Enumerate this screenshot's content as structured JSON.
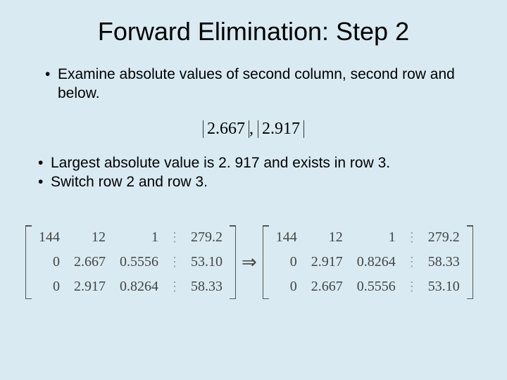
{
  "title": "Forward Elimination: Step 2",
  "bullets_top": [
    "Examine absolute values of second column, second row and below."
  ],
  "abs_expr": {
    "v1": "2.667",
    "comma": ", ",
    "v2": "2.917"
  },
  "bullets_mid": [
    "Largest absolute value is 2. 917 and exists in row 3.",
    "Switch row 2 and row 3."
  ],
  "matrices": {
    "left": {
      "rows": [
        [
          "144",
          "12",
          "1",
          "279.2"
        ],
        [
          "0",
          "2.667",
          "0.5556",
          "53.10"
        ],
        [
          "0",
          "2.917",
          "0.8264",
          "58.33"
        ]
      ]
    },
    "arrow": "⇒",
    "right": {
      "rows": [
        [
          "144",
          "12",
          "1",
          "279.2"
        ],
        [
          "0",
          "2.917",
          "0.8264",
          "58.33"
        ],
        [
          "0",
          "2.667",
          "0.5556",
          "53.10"
        ]
      ]
    },
    "sep_glyph": "⋮"
  }
}
